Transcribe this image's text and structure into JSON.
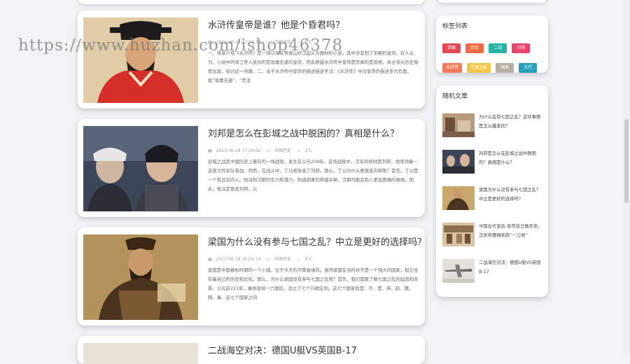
{
  "watermark": "https://www.huzhan.com/ishop46378",
  "articles": [
    {
      "title": "水浒传皇帝是谁？他是个昏君吗？",
      "date": "2023-06-18 17:24:33",
      "category": "历史文化",
      "views": "0℃",
      "excerpt": "一、背景介绍《水浒传》是一部以宋江等梁山好汉起义为题材的小说，其中涉及到了宋朝的皇帝。有人认为，小说中的宋江等人反抗的是昏庸无道的皇帝，因此质疑水浒传中皇帝是否真的是昏君。本文将从历史角度出发，探讨这一问题。二、关于水浒传中皇帝的描述描述手法：《水浒传》中对皇帝的描述多为负面，如“昏庸无道”、“荒淫"
    },
    {
      "title": "刘邦是怎么在彭城之战中脱困的？真相是什么？",
      "date": "2023-06-18 17:24:02",
      "category": "中国历史",
      "views": "1℃",
      "excerpt": "彭城之战是中国历史上著名的一场战役。发生在公元208年。这场战役中，汉军的统帅是刘邦，他率领着一支庞大的军队参战。然而，在战斗中，丁公却放走了刘邦。那么，丁公为什么要放走刘邦呢？首先，丁公是一个有远见的人。他深知汉朝的实力和潜力，知道如果刘邦被杀掉，汉朝可能会陷入更加困难的境地。因此，他决定放走刘邦，以"
    },
    {
      "title": "梁国为什么没有参与七国之乱？中立是更好的选择吗？",
      "date": "2023-06-18 16:53:14",
      "category": "中国历史",
      "views": "0℃",
      "excerpt": "梁国是中国春秋时期的一个小国，位于今天的河南省境内。虽然梁国在当时并不是一个强大的国家，但它也有着自己的历史和文化。那么，为什么梁国没有参与七国之乱呢？首先，我们需要了解七国之乱的起因和背景。公元前221年，秦始皇统一六国后，设立了七个行政区划。这七个国家就是：齐、楚、燕、赵、魏、韩、秦。这七个国家之间"
    },
    {
      "title": "二战海空对决：德国U艇VS英国B-17"
    }
  ],
  "tags_box": {
    "title": "标签列表",
    "tags": [
      {
        "label": "清朝",
        "color": "#e0474f"
      },
      {
        "label": "历史",
        "color": "#ee6a43"
      },
      {
        "label": "二战",
        "color": "#26b3a4"
      },
      {
        "label": "刘邦",
        "color": "#e8436b"
      },
      {
        "label": "水浒传",
        "color": "#f07b5a"
      },
      {
        "label": "七国之乱",
        "color": "#f0c74a"
      },
      {
        "label": "国家",
        "color": "#b6b0a2"
      },
      {
        "label": "古代",
        "color": "#2b9fb9"
      }
    ]
  },
  "random_box": {
    "title": "随机文章",
    "items": [
      {
        "title": "为什么会有七国之乱？这件事情是怎么爆发的？"
      },
      {
        "title": "刘邦是怎么在彭城之战中脱困的？真相是什么？"
      },
      {
        "title": "梁国为什么没有参与七国之乱？中立是更好的选择吗？"
      },
      {
        "title": "中国古代皇店-皇帝自己做买卖，汉灵帝摆摊卖肉“一刀准”"
      },
      {
        "title": "二战海空对决：德国U艇VS英国B-17"
      }
    ]
  }
}
